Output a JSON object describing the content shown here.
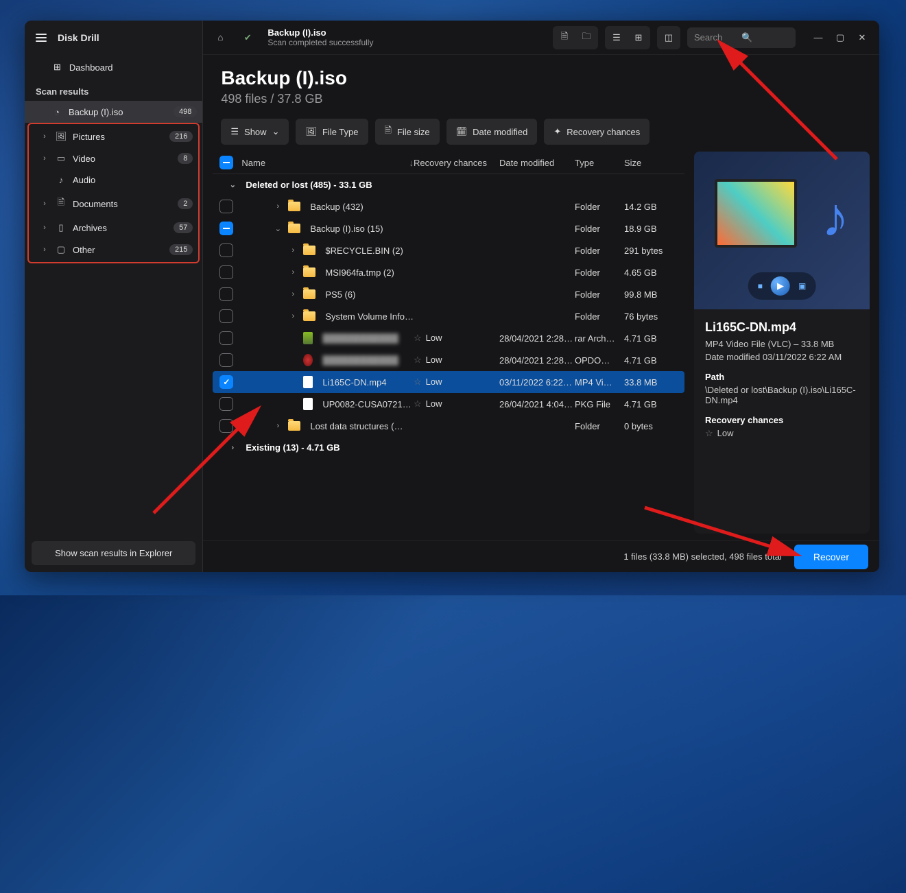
{
  "app": {
    "title": "Disk Drill"
  },
  "sidebar": {
    "dashboard": "Dashboard",
    "section_label": "Scan results",
    "root": {
      "label": "Backup (I).iso",
      "count": "498"
    },
    "cats": [
      {
        "label": "Pictures",
        "count": "216",
        "icon": "🖼"
      },
      {
        "label": "Video",
        "count": "8",
        "icon": "▭"
      },
      {
        "label": "Audio",
        "count": "",
        "icon": "♪"
      },
      {
        "label": "Documents",
        "count": "2",
        "icon": "🗎"
      },
      {
        "label": "Archives",
        "count": "57",
        "icon": "▯"
      },
      {
        "label": "Other",
        "count": "215",
        "icon": "▢"
      }
    ],
    "explorer_btn": "Show scan results in Explorer"
  },
  "title": {
    "main": "Backup (I).iso",
    "sub": "Scan completed successfully"
  },
  "page": {
    "title": "Backup (I).iso",
    "sub": "498 files / 37.8 GB"
  },
  "filters": {
    "show": "Show",
    "file_type": "File Type",
    "file_size": "File size",
    "date_modified": "Date modified",
    "recovery": "Recovery chances"
  },
  "columns": {
    "name": "Name",
    "recovery": "Recovery chances",
    "date": "Date modified",
    "type": "Type",
    "size": "Size"
  },
  "groups": {
    "deleted": "Deleted or lost (485) - 33.1 GB",
    "existing": "Existing (13) - 4.71 GB"
  },
  "rows": [
    {
      "indent": 2,
      "chev": "›",
      "icon": "folder",
      "name": "Backup (432)",
      "rec": "",
      "date": "",
      "type": "Folder",
      "size": "14.2 GB"
    },
    {
      "indent": 2,
      "chev": "⌄",
      "icon": "folder",
      "name": "Backup (I).iso (15)",
      "rec": "",
      "date": "",
      "type": "Folder",
      "size": "18.9 GB",
      "indet": true
    },
    {
      "indent": 3,
      "chev": "›",
      "icon": "folder",
      "name": "$RECYCLE.BIN (2)",
      "rec": "",
      "date": "",
      "type": "Folder",
      "size": "291 bytes"
    },
    {
      "indent": 3,
      "chev": "›",
      "icon": "folder",
      "name": "MSI964fa.tmp (2)",
      "rec": "",
      "date": "",
      "type": "Folder",
      "size": "4.65 GB"
    },
    {
      "indent": 3,
      "chev": "›",
      "icon": "folder",
      "name": "PS5 (6)",
      "rec": "",
      "date": "",
      "type": "Folder",
      "size": "99.8 MB"
    },
    {
      "indent": 3,
      "chev": "›",
      "icon": "folder",
      "name": "System Volume Info…",
      "rec": "",
      "date": "",
      "type": "Folder",
      "size": "76 bytes"
    },
    {
      "indent": 3,
      "chev": "",
      "icon": "rar",
      "name": "████████████",
      "rec": "Low",
      "date": "28/04/2021 2:28…",
      "type": "rar Arch…",
      "size": "4.71 GB",
      "blur": true
    },
    {
      "indent": 3,
      "chev": "",
      "icon": "opd",
      "name": "████████████",
      "rec": "Low",
      "date": "28/04/2021 2:28…",
      "type": "OPDO…",
      "size": "4.71 GB",
      "blur": true
    },
    {
      "indent": 3,
      "chev": "",
      "icon": "mp4",
      "name": "Li165C-DN.mp4",
      "rec": "Low",
      "date": "03/11/2022 6:22…",
      "type": "MP4 Vi…",
      "size": "33.8 MB",
      "selected": true,
      "checked": true
    },
    {
      "indent": 3,
      "chev": "",
      "icon": "pkg",
      "name": "UP0082-CUSA0721…",
      "rec": "Low",
      "date": "26/04/2021 4:04…",
      "type": "PKG File",
      "size": "4.71 GB"
    },
    {
      "indent": 2,
      "chev": "›",
      "icon": "folder",
      "name": "Lost data structures (…",
      "rec": "",
      "date": "",
      "type": "Folder",
      "size": "0 bytes"
    }
  ],
  "preview": {
    "filename": "Li165C-DN.mp4",
    "meta": "MP4 Video File (VLC) – 33.8 MB",
    "modified": "Date modified 03/11/2022 6:22 AM",
    "path_label": "Path",
    "path": "\\Deleted or lost\\Backup (I).iso\\Li165C-DN.mp4",
    "rec_label": "Recovery chances",
    "rec_value": "Low"
  },
  "status": {
    "text": "1 files (33.8 MB) selected, 498 files total",
    "recover": "Recover"
  },
  "search": {
    "placeholder": "Search"
  }
}
